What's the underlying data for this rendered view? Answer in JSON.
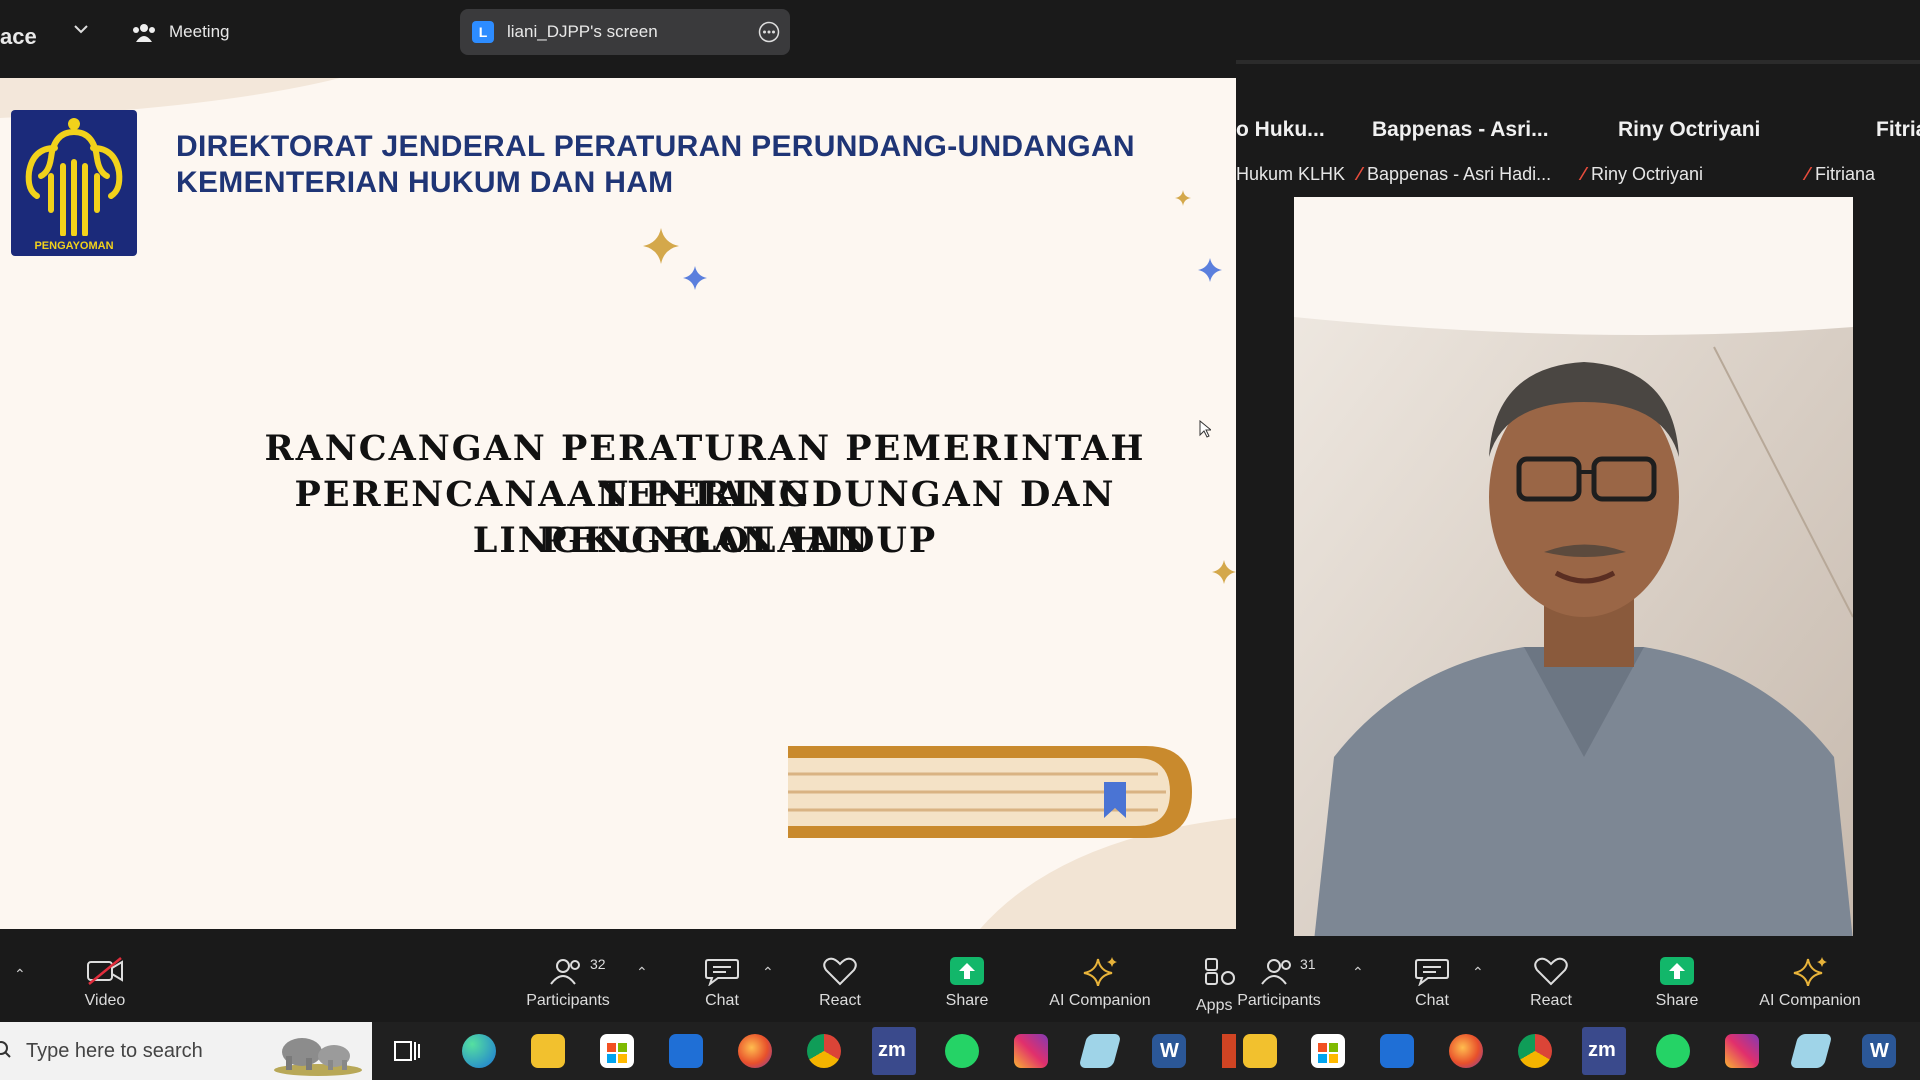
{
  "left_window": {
    "title_fragment": "ace",
    "meeting_label": "Meeting",
    "share_avatar": "L",
    "share_label": "liani_DJPP's screen"
  },
  "slide": {
    "logo_text": "PENGAYOMAN",
    "header_line1": "DIREKTORAT JENDERAL PERATURAN PERUNDANG-UNDANGAN",
    "header_line2": "KEMENTERIAN HUKUM DAN HAM",
    "title_line1": "RANCANGAN PERATURAN PEMERINTAH TENTANG",
    "title_line2": "PERENCANAAN PERLINDUNGAN DAN PENGELOLAAN",
    "title_line3": "LINGKUNGAN HIDUP",
    "colors": {
      "navy": "#1f3576",
      "gold": "#d4a84b",
      "blue_star": "#5b7fdd"
    }
  },
  "left_toolbar": {
    "video": "Video",
    "participants": "Participants",
    "participants_count": "32",
    "chat": "Chat",
    "react": "React",
    "share": "Share",
    "ai": "AI Companion",
    "apps": "Apps"
  },
  "right_window": {
    "tiles": [
      {
        "name": "o Huku...",
        "sub": "Hukum KLHK"
      },
      {
        "name": "Bappenas - Asri...",
        "sub": "Bappenas - Asri Hadi..."
      },
      {
        "name": "Riny Octriyani",
        "sub": "Riny Octriyani"
      },
      {
        "name": "Fitria",
        "sub": "Fitriana"
      }
    ]
  },
  "right_toolbar": {
    "participants": "Participants",
    "participants_count": "31",
    "chat": "Chat",
    "react": "React",
    "share": "Share",
    "ai": "AI Companion"
  },
  "taskbar": {
    "search_placeholder": "Type here to search",
    "zoom_label": "zm",
    "word_label": "W",
    "icons": [
      "task-view-icon",
      "edge-icon",
      "file-explorer-icon",
      "store-icon",
      "mail-icon",
      "firefox-icon",
      "chrome-icon",
      "zoom-icon",
      "whatsapp-icon",
      "instagram-icon",
      "notes-icon",
      "word-icon"
    ]
  }
}
